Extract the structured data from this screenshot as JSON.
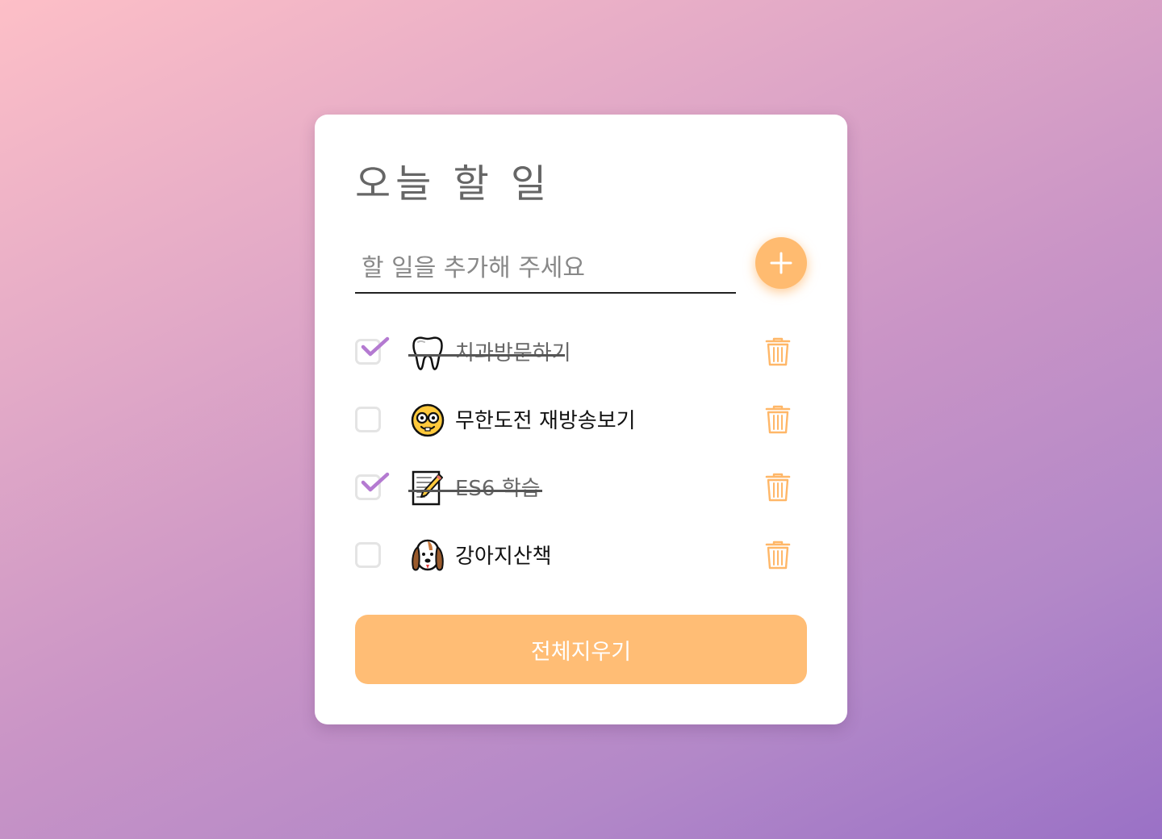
{
  "app": {
    "title": "오늘 할 일"
  },
  "input": {
    "placeholder": "할 일을 추가해 주세요",
    "value": ""
  },
  "add_button": {
    "icon": "plus-icon"
  },
  "todos": [
    {
      "text": "치과방문하기",
      "done": true,
      "emoji": "tooth"
    },
    {
      "text": "무한도전 재방송보기",
      "done": false,
      "emoji": "nerd-face"
    },
    {
      "text": "ES6 학습",
      "done": true,
      "emoji": "memo"
    },
    {
      "text": "강아지산책",
      "done": false,
      "emoji": "dog"
    }
  ],
  "clear_button": {
    "label": "전체지우기"
  },
  "colors": {
    "accent": "#ffbb70",
    "check": "#b47ad1",
    "trash": "#ffb768",
    "background_start": "#fdbfc7",
    "background_end": "#9a71c6"
  }
}
